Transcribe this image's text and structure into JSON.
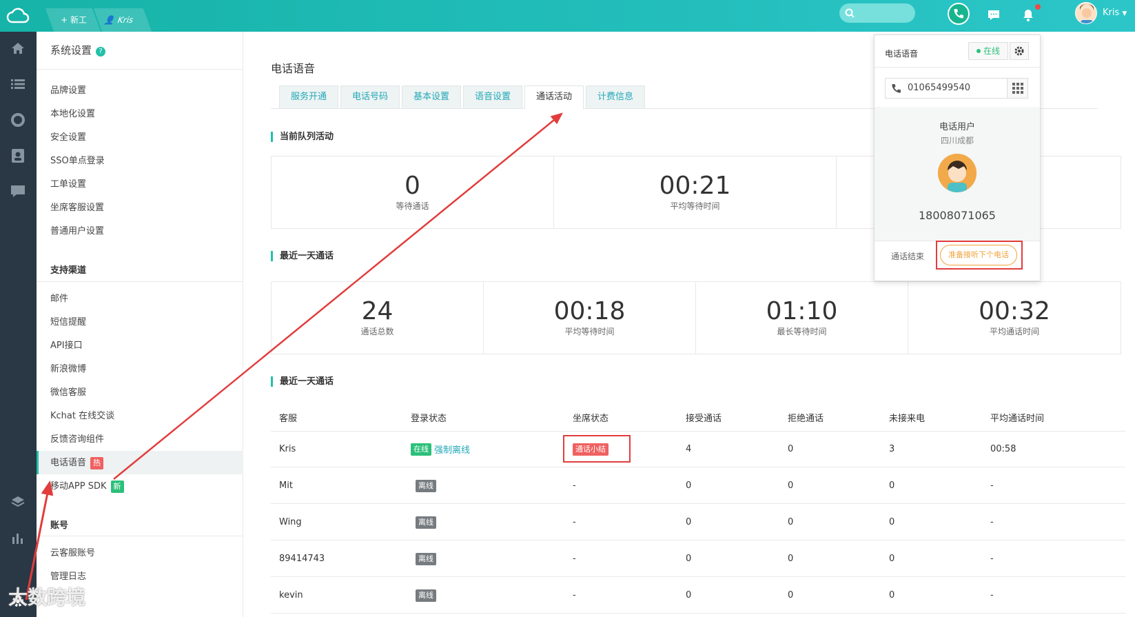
{
  "topbar": {
    "new_ticket": "+ 新工单",
    "user_tab": "Kris",
    "username": "Kris",
    "colors": {
      "bar": "#16b3a8",
      "phone": "#16b58f"
    }
  },
  "sidebar": {
    "title": "系统设置",
    "help": "?",
    "items1": [
      "品牌设置",
      "本地化设置",
      "安全设置",
      "SSO单点登录",
      "工单设置",
      "坐席客服设置",
      "普通用户设置"
    ],
    "group2": "支持渠道",
    "items2": [
      "邮件",
      "短信提醒",
      "API接口",
      "新浪微博",
      "微信客服",
      "Kchat 在线交谈",
      "反馈咨询组件",
      "电话语音",
      "移动APP SDK"
    ],
    "hot_badge": "热",
    "new_badge": "新",
    "group3": "账号",
    "items3": [
      "云客服账号",
      "管理日志"
    ]
  },
  "main": {
    "page_title": "电话语音",
    "tabs": [
      "服务开通",
      "电话号码",
      "基本设置",
      "语音设置",
      "通话活动",
      "计费信息"
    ],
    "queue_title": "当前队列活动",
    "queue_stats": [
      {
        "value": "0",
        "label": "等待通话"
      },
      {
        "value": "00:21",
        "label": "平均等待时间"
      }
    ],
    "day_title": "最近一天通话",
    "day_stats": [
      {
        "value": "24",
        "label": "通话总数"
      },
      {
        "value": "00:18",
        "label": "平均等待时间"
      },
      {
        "value": "01:10",
        "label": "最长等待时间"
      },
      {
        "value": "00:32",
        "label": "平均通话时间"
      }
    ],
    "table_title": "最近一天通话",
    "table": {
      "headers": [
        "客服",
        "登录状态",
        "坐席状态",
        "接受通话",
        "拒绝通话",
        "未接来电",
        "平均通话时间"
      ],
      "force_offline": "强制离线",
      "rows": [
        {
          "agent": "Kris",
          "login": "在线",
          "seat": "通话小结",
          "accepted": "4",
          "rejected": "0",
          "missed": "3",
          "avg": "00:58"
        },
        {
          "agent": "Mit",
          "login": "离线",
          "seat": "-",
          "accepted": "0",
          "rejected": "0",
          "missed": "0",
          "avg": "-"
        },
        {
          "agent": "Wing",
          "login": "离线",
          "seat": "-",
          "accepted": "0",
          "rejected": "0",
          "missed": "0",
          "avg": "-"
        },
        {
          "agent": "89414743",
          "login": "离线",
          "seat": "-",
          "accepted": "0",
          "rejected": "0",
          "missed": "0",
          "avg": "-"
        },
        {
          "agent": "kevin",
          "login": "离线",
          "seat": "-",
          "accepted": "0",
          "rejected": "0",
          "missed": "0",
          "avg": "-"
        }
      ]
    }
  },
  "popup": {
    "title": "电话语音",
    "status": "在线",
    "number": "01065499540",
    "caller_name": "电话用户",
    "caller_location": "四川成都",
    "caller_phone": "18008071065",
    "ended": "通话结束",
    "ready": "准备接听下个电话"
  },
  "watermark": "大数跨境"
}
